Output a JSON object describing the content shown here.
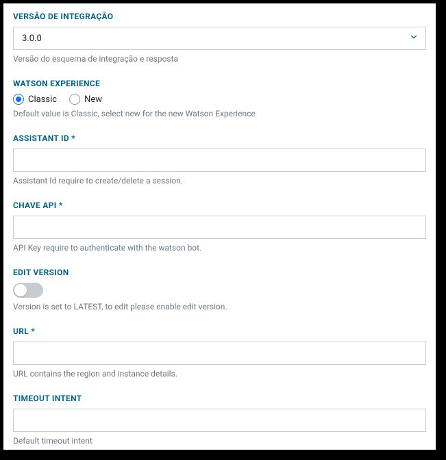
{
  "form": {
    "version": {
      "label": "VERSÃO DE INTEGRAÇÃO",
      "value": "3.0.0",
      "help": "Versão do esquema de integração e resposta"
    },
    "experience": {
      "label": "WATSON EXPERIENCE",
      "options": {
        "classic": "Classic",
        "new": "New"
      },
      "selected": "classic",
      "help": "Default value is Classic, select new for the new Watson Experience"
    },
    "assistant_id": {
      "label": "ASSISTANT ID *",
      "value": "",
      "help": "Assistant Id require to create/delete a session."
    },
    "api_key": {
      "label": "CHAVE API *",
      "value": "",
      "help": "API Key require to authenticate with the watson bot."
    },
    "edit_version": {
      "label": "EDIT VERSION",
      "enabled": false,
      "help": "Version is set to LATEST, to edit please enable edit version."
    },
    "url": {
      "label": "URL *",
      "value": "",
      "help": "URL contains the region and instance details."
    },
    "timeout_intent": {
      "label": "TIMEOUT INTENT",
      "value": "",
      "help": "Default timeout intent"
    }
  }
}
